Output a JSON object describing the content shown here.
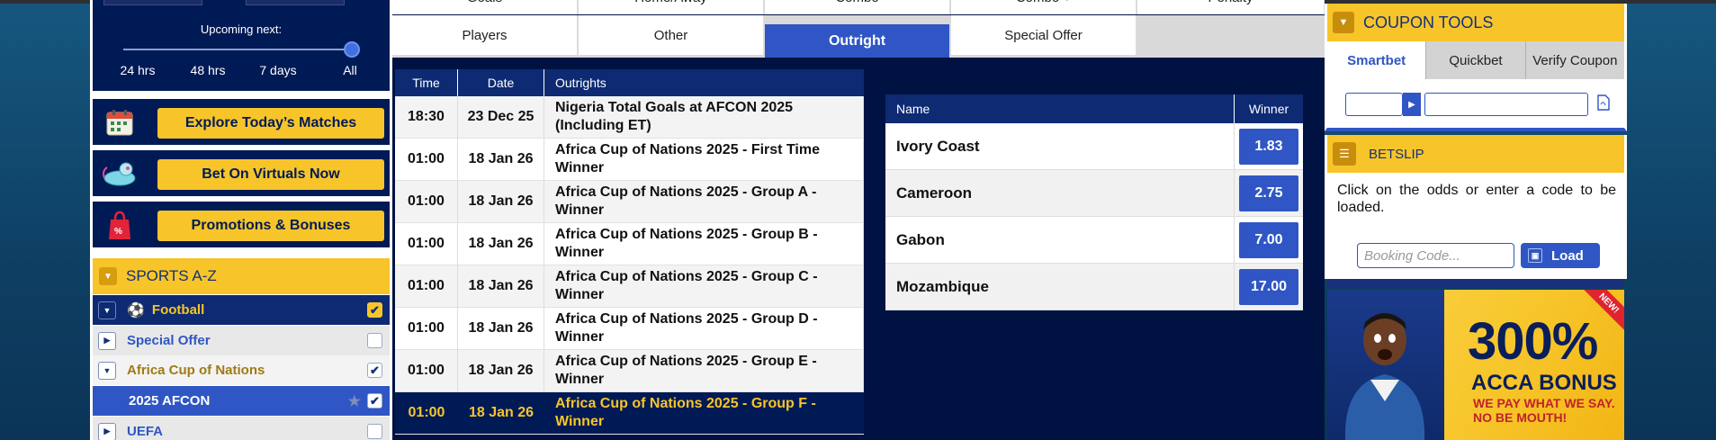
{
  "upcoming": {
    "label": "Upcoming next:",
    "stops": [
      "24 hrs",
      "48 hrs",
      "7 days",
      "All"
    ],
    "selected": "All"
  },
  "promos": [
    {
      "label": "Explore Today’s Matches",
      "icon": "calendar-icon"
    },
    {
      "label": "Bet On Virtuals Now",
      "icon": "virtual-mouse-icon"
    },
    {
      "label": "Promotions & Bonuses",
      "icon": "shopping-bag-icon"
    }
  ],
  "sports_az": {
    "title": "SPORTS A-Z",
    "items": [
      {
        "label": "Football",
        "checked": true
      },
      {
        "label": "Special Offer",
        "checked": false
      },
      {
        "label": "Africa Cup of Nations",
        "checked": true
      },
      {
        "label": "2025 AFCON",
        "checked": true
      },
      {
        "label": "UEFA",
        "checked": false
      }
    ]
  },
  "market_tabs": {
    "row1": [
      "Goals",
      "Home/Away",
      "Combo",
      "Combo +",
      "Penalty"
    ],
    "row2": [
      "Players",
      "Other",
      "Outright",
      "Special Offer"
    ],
    "active": "Outright"
  },
  "outrights": {
    "headers": [
      "Time",
      "Date",
      "Outrights"
    ],
    "rows": [
      {
        "time": "18:30",
        "date": "23 Dec 25",
        "name": "Nigeria Total Goals at AFCON 2025 (Including ET)"
      },
      {
        "time": "01:00",
        "date": "18 Jan 26",
        "name": "Africa Cup of Nations 2025 - First Time Winner"
      },
      {
        "time": "01:00",
        "date": "18 Jan 26",
        "name": "Africa Cup of Nations 2025 - Group A - Winner"
      },
      {
        "time": "01:00",
        "date": "18 Jan 26",
        "name": "Africa Cup of Nations 2025 - Group B - Winner"
      },
      {
        "time": "01:00",
        "date": "18 Jan 26",
        "name": "Africa Cup of Nations 2025 - Group C - Winner"
      },
      {
        "time": "01:00",
        "date": "18 Jan 26",
        "name": "Africa Cup of Nations 2025 - Group D - Winner"
      },
      {
        "time": "01:00",
        "date": "18 Jan 26",
        "name": "Africa Cup of Nations 2025 - Group E - Winner"
      },
      {
        "time": "01:00",
        "date": "18 Jan 26",
        "name": "Africa Cup of Nations 2025 - Group F - Winner"
      }
    ],
    "selected_index": 7
  },
  "winner_table": {
    "headers": [
      "Name",
      "Winner"
    ],
    "rows": [
      {
        "name": "Ivory Coast",
        "odds": "1.83"
      },
      {
        "name": "Cameroon",
        "odds": "2.75"
      },
      {
        "name": "Gabon",
        "odds": "7.00"
      },
      {
        "name": "Mozambique",
        "odds": "17.00"
      }
    ]
  },
  "coupon_tools": {
    "title": "COUPON TOOLS",
    "tabs": [
      "Smartbet",
      "Quickbet",
      "Verify Coupon"
    ],
    "active": "Smartbet"
  },
  "betslip": {
    "title": "BETSLIP",
    "message": "Click on the odds or enter a code to be loaded.",
    "booking_placeholder": "Booking Code...",
    "load_label": "Load"
  },
  "banner": {
    "percent": "300%",
    "headline": "ACCA BONUS",
    "tagline_1": "WE PAY WHAT WE SAY.",
    "tagline_2": "NO BE MOUTH!",
    "tag": "NEW!"
  },
  "colors": {
    "navy": "#001a55",
    "accent_blue": "#2f56c4",
    "yellow": "#f7c52a"
  }
}
